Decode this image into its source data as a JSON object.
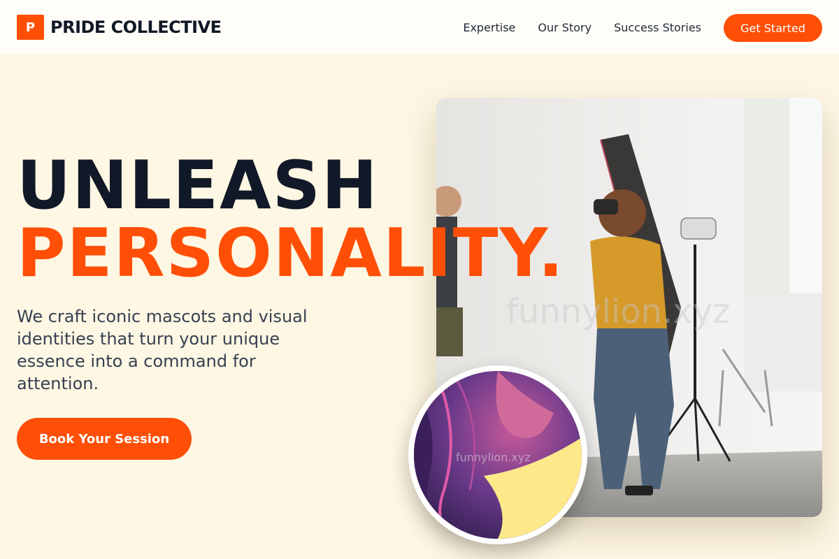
{
  "header": {
    "logo_mark": "P",
    "brand": "PRIDE COLLECTIVE",
    "nav": [
      {
        "label": "Expertise"
      },
      {
        "label": "Our Story"
      },
      {
        "label": "Success Stories"
      }
    ],
    "cta_label": "Get Started"
  },
  "hero": {
    "headline_line1": "UNLEASH",
    "headline_line2": "PERSONALITY.",
    "subtitle": "We craft iconic mascots and visual identities that turn your unique essence into a command for attention.",
    "button_label": "Book Your Session",
    "photo_watermark": "funnylion.xyz",
    "circle_watermark": "funnylion.xyz"
  },
  "colors": {
    "accent": "#ff4f06",
    "background": "#fef7e4",
    "header_bg": "#fffdf8",
    "heading": "#111827"
  },
  "icons": {
    "logo": "logo-icon"
  }
}
